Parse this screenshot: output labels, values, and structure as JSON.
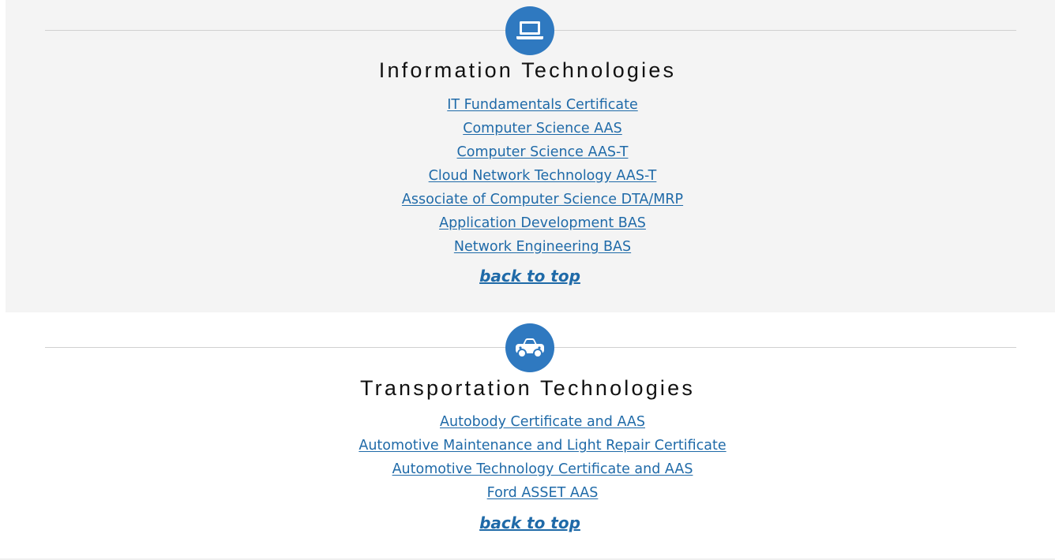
{
  "sections": [
    {
      "icon": "laptop-icon",
      "title": "Information Technologies",
      "links": [
        "IT Fundamentals Certificate",
        "Computer Science AAS",
        "Computer Science AAS-T",
        "Cloud Network Technology AAS-T",
        "Associate of Computer Science DTA/MRP",
        "Application Development BAS",
        "Network Engineering BAS"
      ],
      "back_to_top": "back to top"
    },
    {
      "icon": "car-icon",
      "title": "Transportation Technologies",
      "links": [
        "Autobody Certificate and AAS",
        "Automotive Maintenance and Light Repair Certificate",
        "Automotive Technology Certificate and AAS",
        "Ford ASSET AAS"
      ],
      "back_to_top": "back to top"
    }
  ],
  "colors": {
    "accent": "#2f79c0",
    "link": "#1f6aa8",
    "section_bg": "#f4f4f4",
    "divider": "#d0d0d0"
  }
}
